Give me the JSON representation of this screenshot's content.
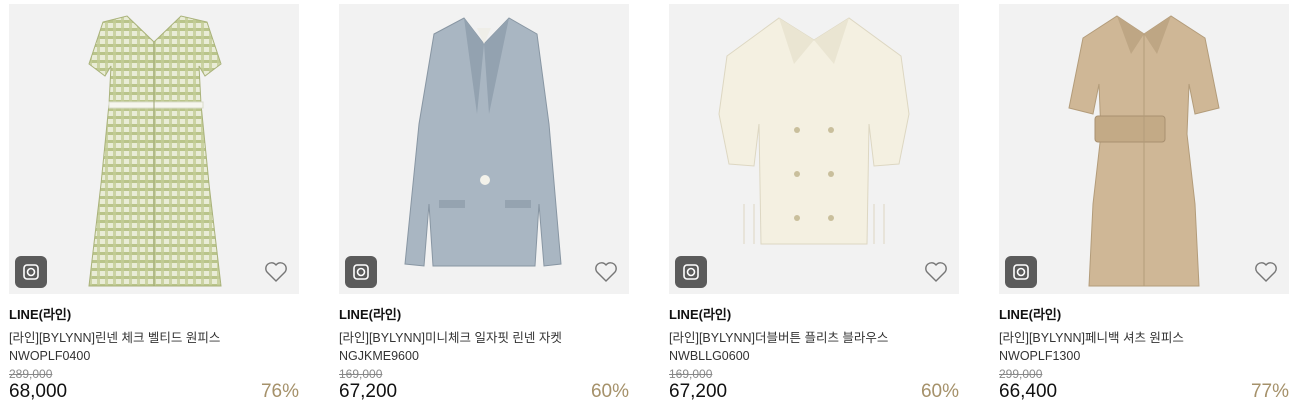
{
  "products": [
    {
      "brand": "LINE(라인)",
      "name": "[라인][BYLYNN]린넨 체크 벨티드 원피스",
      "code": "NWOPLF0400",
      "original_price": "289,000",
      "price": "68,000",
      "discount": "76%"
    },
    {
      "brand": "LINE(라인)",
      "name": "[라인][BYLYNN]미니체크 일자핏 린넨 자켓",
      "code": "NGJKME9600",
      "original_price": "169,000",
      "price": "67,200",
      "discount": "60%"
    },
    {
      "brand": "LINE(라인)",
      "name": "[라인][BYLYNN]더블버튼 플리츠 블라우스",
      "code": "NWBLLG0600",
      "original_price": "169,000",
      "price": "67,200",
      "discount": "60%"
    },
    {
      "brand": "LINE(라인)",
      "name": "[라인][BYLYNN]페니백 셔츠 원피스",
      "code": "NWOPLF1300",
      "original_price": "299,000",
      "price": "66,400",
      "discount": "77%"
    }
  ],
  "icons": {
    "camera": "camera-icon",
    "wishlist": "heart-icon"
  },
  "colors": {
    "discount": "#a5916a",
    "badge": "#5b5b5b",
    "image_bg": "#f2f2f2"
  }
}
